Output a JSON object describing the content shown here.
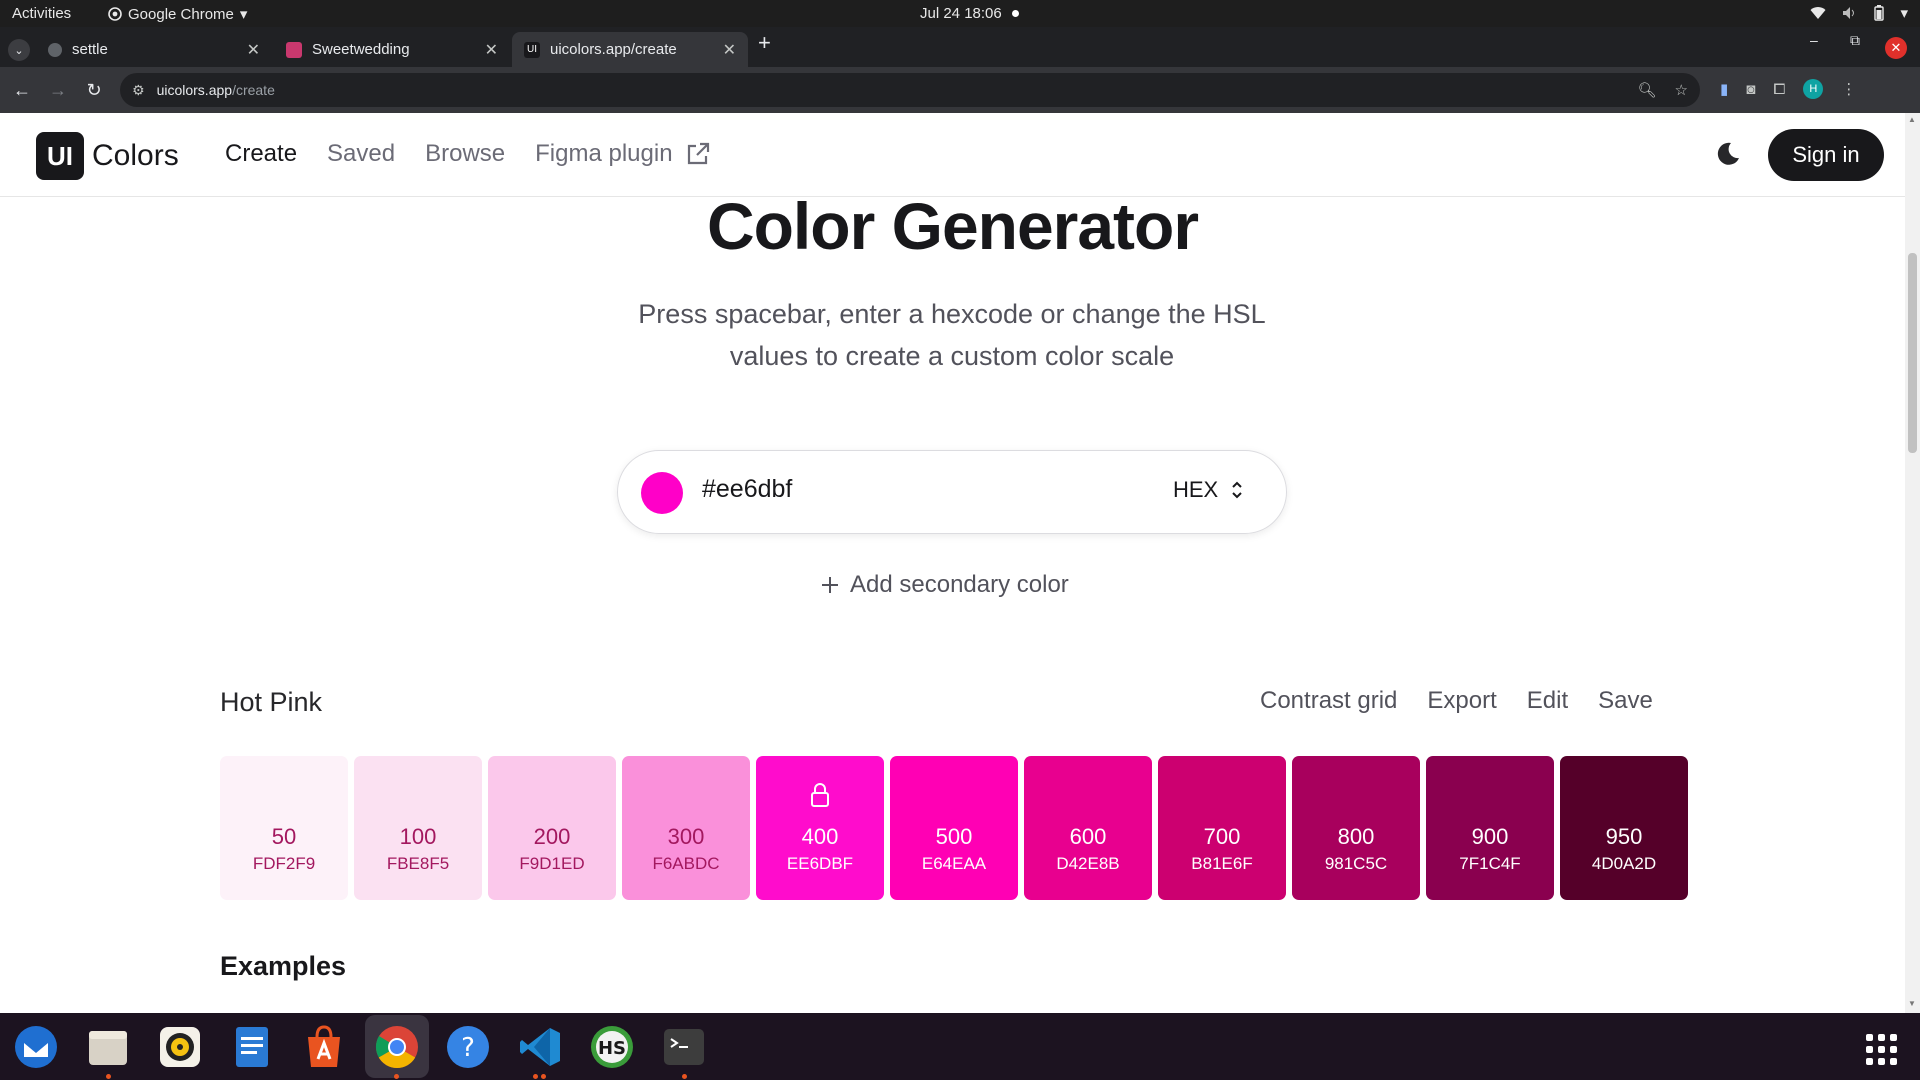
{
  "system": {
    "activities": "Activities",
    "app_name": "Google Chrome",
    "clock": "Jul 24  18:06"
  },
  "browser": {
    "tabs": [
      {
        "title": "settle",
        "favicon": "globe-icon"
      },
      {
        "title": "Sweetwedding",
        "favicon": "site-icon"
      },
      {
        "title": "uicolors.app/create",
        "favicon": "uicolors-icon",
        "favicon_text": "UI",
        "active": true
      }
    ],
    "new_tab": "+",
    "url_host": "uicolors.app",
    "url_path": "/create",
    "profile_initial": "H"
  },
  "site": {
    "logo_mark": "UI",
    "logo_word": "Colors",
    "nav": [
      {
        "label": "Create",
        "active": true
      },
      {
        "label": "Saved"
      },
      {
        "label": "Browse"
      },
      {
        "label": "Figma plugin"
      }
    ],
    "sign_in": "Sign in"
  },
  "hero": {
    "title": "Color Generator",
    "subtitle": "Press spacebar, enter a hexcode or change the HSL values to create a custom color scale"
  },
  "color_input": {
    "value": "#ee6dbf",
    "swatch_color": "#ff00c8",
    "format": "HEX"
  },
  "add_secondary": "Add secondary color",
  "scale": {
    "name": "Hot Pink",
    "actions": [
      "Contrast grid",
      "Export",
      "Edit",
      "Save"
    ],
    "shades": [
      {
        "step": "50",
        "hex": "FDF2F9",
        "bg": "#fdf2f9",
        "fg": "#a3185f"
      },
      {
        "step": "100",
        "hex": "FBE8F5",
        "bg": "#fbe1f2",
        "fg": "#a3185f"
      },
      {
        "step": "200",
        "hex": "F9D1ED",
        "bg": "#fbc8eb",
        "fg": "#a3185f"
      },
      {
        "step": "300",
        "hex": "F6ABDC",
        "bg": "#fa90da",
        "fg": "#a3185f"
      },
      {
        "step": "400",
        "hex": "EE6DBF",
        "bg": "#ff0ccc",
        "fg": "#ffffff",
        "locked": true
      },
      {
        "step": "500",
        "hex": "E64EAA",
        "bg": "#ff00b4",
        "fg": "#ffffff"
      },
      {
        "step": "600",
        "hex": "D42E8B",
        "bg": "#e8008f",
        "fg": "#ffffff"
      },
      {
        "step": "700",
        "hex": "B81E6F",
        "bg": "#cc0070",
        "fg": "#ffffff"
      },
      {
        "step": "800",
        "hex": "981C5C",
        "bg": "#a8005d",
        "fg": "#ffffff"
      },
      {
        "step": "900",
        "hex": "7F1C4F",
        "bg": "#8a004f",
        "fg": "#ffffff"
      },
      {
        "step": "950",
        "hex": "4D0A2D",
        "bg": "#550029",
        "fg": "#ffffff"
      }
    ]
  },
  "examples_heading": "Examples",
  "dock": [
    "thunderbird-icon",
    "files-icon",
    "rhythmbox-icon",
    "writer-icon",
    "app-center-icon",
    "chrome-icon",
    "help-icon",
    "vscode-icon",
    "hs-icon",
    "terminal-icon"
  ]
}
